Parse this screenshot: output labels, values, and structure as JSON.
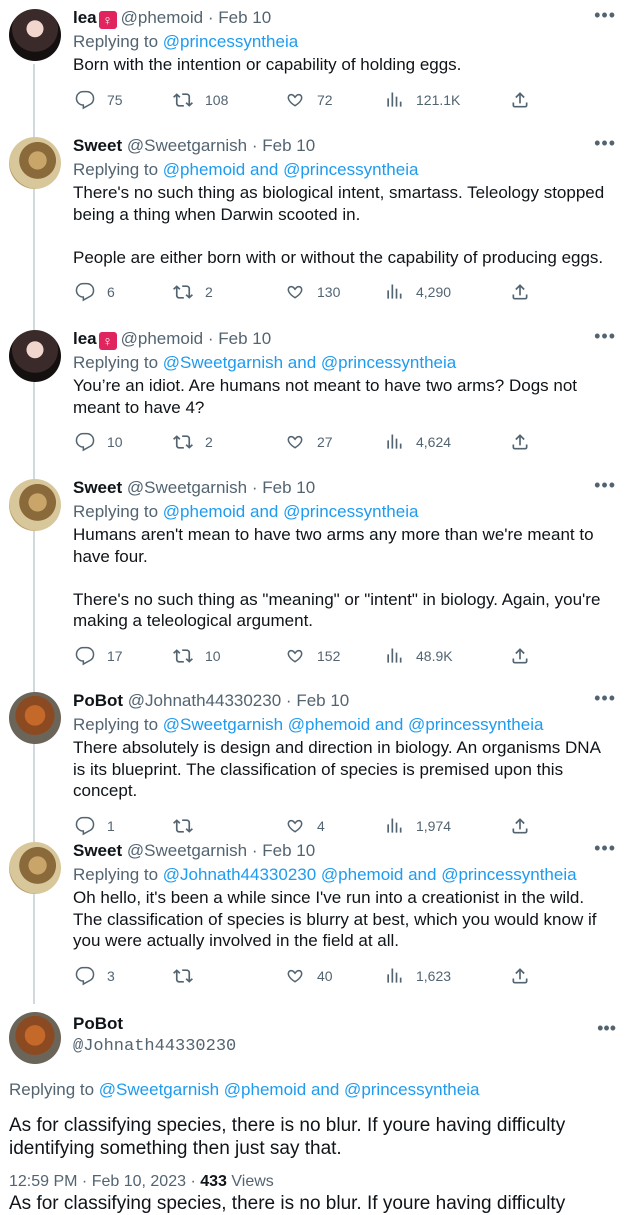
{
  "tweets": [
    {
      "id": "lea1",
      "name": "lea",
      "gender_badge": "♀",
      "handle": "@phemoid",
      "dot": "·",
      "date": "Feb 10",
      "reply_prefix": "Replying to",
      "reply_to": "@princessyntheia",
      "text": "Born with the intention or capability of holding eggs.",
      "replies": "75",
      "retweets": "108",
      "likes": "72",
      "views": "121.1K",
      "avatar": "lea"
    },
    {
      "id": "sweet1",
      "name": "Sweet",
      "handle": "@Sweetgarnish",
      "dot": "·",
      "date": "Feb 10",
      "reply_prefix": "Replying to",
      "reply_to": "@phemoid and @princessyntheia",
      "text": "There's no such thing as biological intent, smartass. Teleology stopped being a thing when Darwin scooted in.\n\nPeople are either born with or without the capability of producing eggs.",
      "replies": "6",
      "retweets": "2",
      "likes": "130",
      "views": "4,290",
      "avatar": "sweet"
    },
    {
      "id": "lea2",
      "name": "lea",
      "gender_badge": "♀",
      "handle": "@phemoid",
      "dot": "·",
      "date": "Feb 10",
      "reply_prefix": "Replying to",
      "reply_to": "@Sweetgarnish and @princessyntheia",
      "text": "You’re an idiot. Are humans not meant to have two arms? Dogs not meant to have 4?",
      "replies": "10",
      "retweets": "2",
      "likes": "27",
      "views": "4,624",
      "avatar": "lea"
    },
    {
      "id": "sweet2",
      "name": "Sweet",
      "handle": "@Sweetgarnish",
      "dot": "·",
      "date": "Feb 10",
      "reply_prefix": "Replying to",
      "reply_to": "@phemoid and @princessyntheia",
      "text": "Humans aren't mean to have two arms any more than we're meant to have four.\n\nThere's no such thing as \"meaning\" or \"intent\" in biology. Again, you're making a teleological argument.",
      "replies": "17",
      "retweets": "10",
      "likes": "152",
      "views": "48.9K",
      "avatar": "sweet"
    },
    {
      "id": "pobot1",
      "name": "PoBot",
      "handle": "@Johnath44330230",
      "dot": "·",
      "date": "Feb 10",
      "reply_prefix": "Replying to",
      "reply_to": "@Sweetgarnish @phemoid and @princessyntheia",
      "text": "There absolutely is design and direction in biology. An organisms DNA is its blueprint. The classification of species is premised upon this concept.",
      "replies": "1",
      "retweets": "",
      "likes": "4",
      "views": "1,974",
      "avatar": "pobot"
    },
    {
      "id": "sweet3",
      "name": "Sweet",
      "handle": "@Sweetgarnish",
      "dot": "·",
      "date": "Feb 10",
      "reply_prefix": "Replying to",
      "reply_to": "@Johnath44330230 @phemoid and @princessyntheia",
      "text": "Oh hello, it's been a while since I've run into a creationist in the wild. The classification of species is blurry at best, which you would know if you were actually involved in the field at all.",
      "replies": "3",
      "retweets": "",
      "likes": "40",
      "views": "1,623",
      "avatar": "sweet"
    }
  ],
  "final": {
    "name": "PoBot",
    "handle": "@Johnath44330230",
    "reply_prefix": "Replying to",
    "reply_to": "@Sweetgarnish @phemoid and @princessyntheia",
    "text": "As for classifying species, there is no blur. If youre having difficulty identifying something then just say that.",
    "time": "12:59 PM · Feb 10, 2023 ·",
    "views_count": "433",
    "views_label": "Views",
    "cutoff_text": "As for classifying species, there is no blur. If youre having difficulty"
  },
  "icons": {
    "more": "more-icon",
    "reply": "reply-icon",
    "retweet": "retweet-icon",
    "like": "heart-icon",
    "views": "views-icon",
    "share": "share-icon"
  },
  "colors": {
    "link": "#1d9bf0",
    "muted": "#536471",
    "text": "#0f1419",
    "thread_line": "#cfd9de"
  }
}
